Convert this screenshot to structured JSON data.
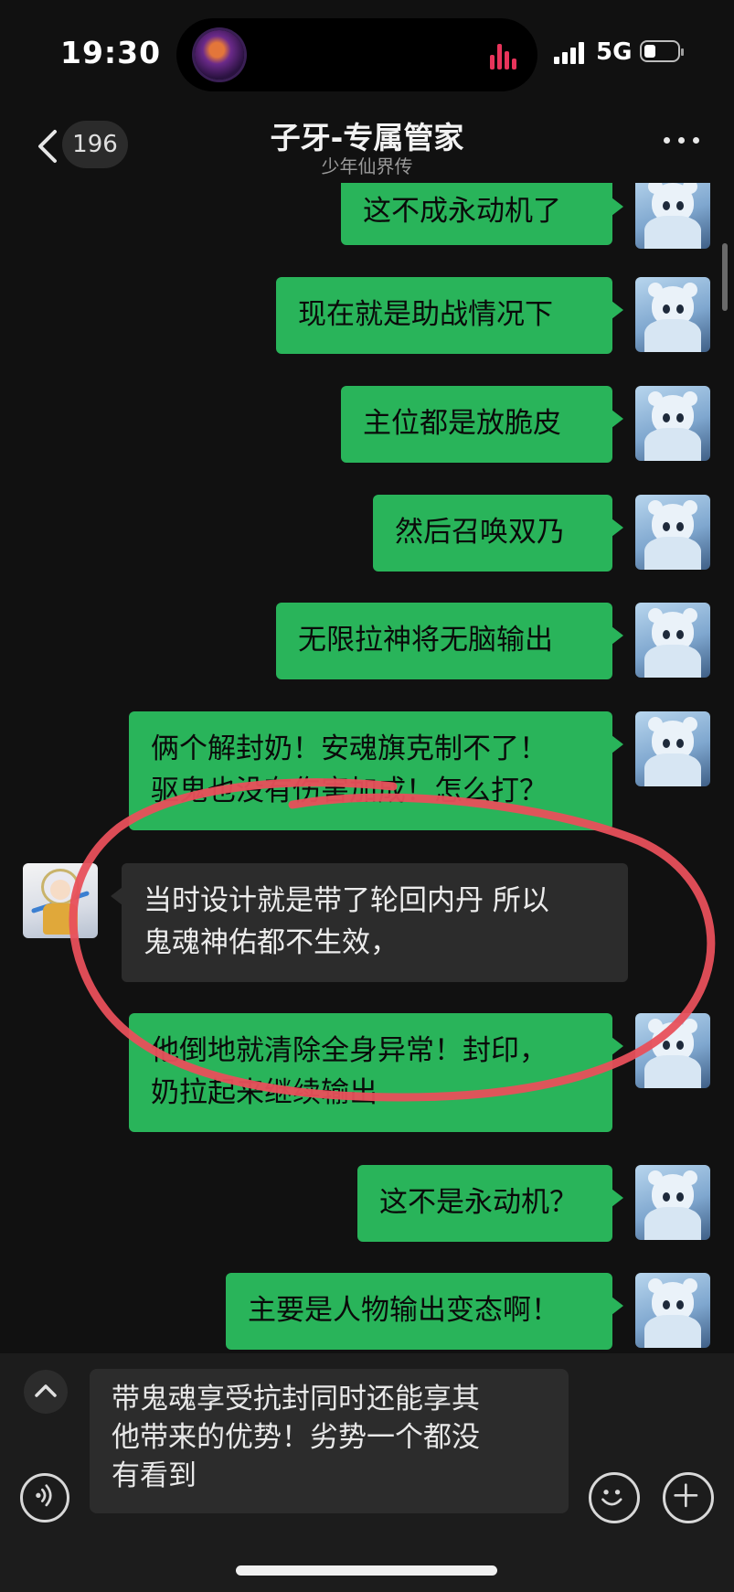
{
  "status_bar": {
    "time": "19:30",
    "network": "5G",
    "icons": [
      "music-visualizer-icon",
      "signal-icon",
      "battery-icon"
    ]
  },
  "header": {
    "back_count": "196",
    "title": "子牙-专属管家",
    "subtitle": "少年仙界传",
    "icons": [
      "chevron-left-icon",
      "more-icon"
    ]
  },
  "messages": [
    {
      "sender": "me",
      "lines": [
        "这不成永动机了"
      ]
    },
    {
      "sender": "me",
      "lines": [
        "现在就是助战情况下"
      ]
    },
    {
      "sender": "me",
      "lines": [
        "主位都是放脆皮"
      ]
    },
    {
      "sender": "me",
      "lines": [
        "然后召唤双乃"
      ]
    },
    {
      "sender": "me",
      "lines": [
        "无限拉神将无脑输出"
      ]
    },
    {
      "sender": "me",
      "lines": [
        "俩个解封奶！安魂旗克制不了！",
        "驱鬼也没有伤害加成！怎么打？"
      ]
    },
    {
      "sender": "other",
      "lines": [
        "当时设计就是带了轮回内丹 所以",
        "鬼魂神佑都不生效，"
      ]
    },
    {
      "sender": "me",
      "lines": [
        "他倒地就清除全身异常！封印，",
        "奶拉起来继续输出"
      ]
    },
    {
      "sender": "me",
      "lines": [
        "这不是永动机？"
      ]
    },
    {
      "sender": "me",
      "lines": [
        "主要是人物输出变态啊！"
      ]
    }
  ],
  "annotation": {
    "type": "hand-drawn-circle",
    "color": "#e8505b"
  },
  "input": {
    "value": "带鬼魂享受抗封同时还能享其他带来的优势！劣势一个都没有看到",
    "lines": [
      "带鬼魂享受抗封同时还能享其",
      "他带来的优势！劣势一个都没",
      "有看到"
    ],
    "icons": [
      "chevron-up-icon",
      "voice-icon",
      "emoji-icon",
      "plus-icon"
    ]
  },
  "colors": {
    "background": "#111111",
    "my_bubble": "#29b45a",
    "other_bubble": "#2c2c2c",
    "input_bar": "#1c1c1c"
  }
}
